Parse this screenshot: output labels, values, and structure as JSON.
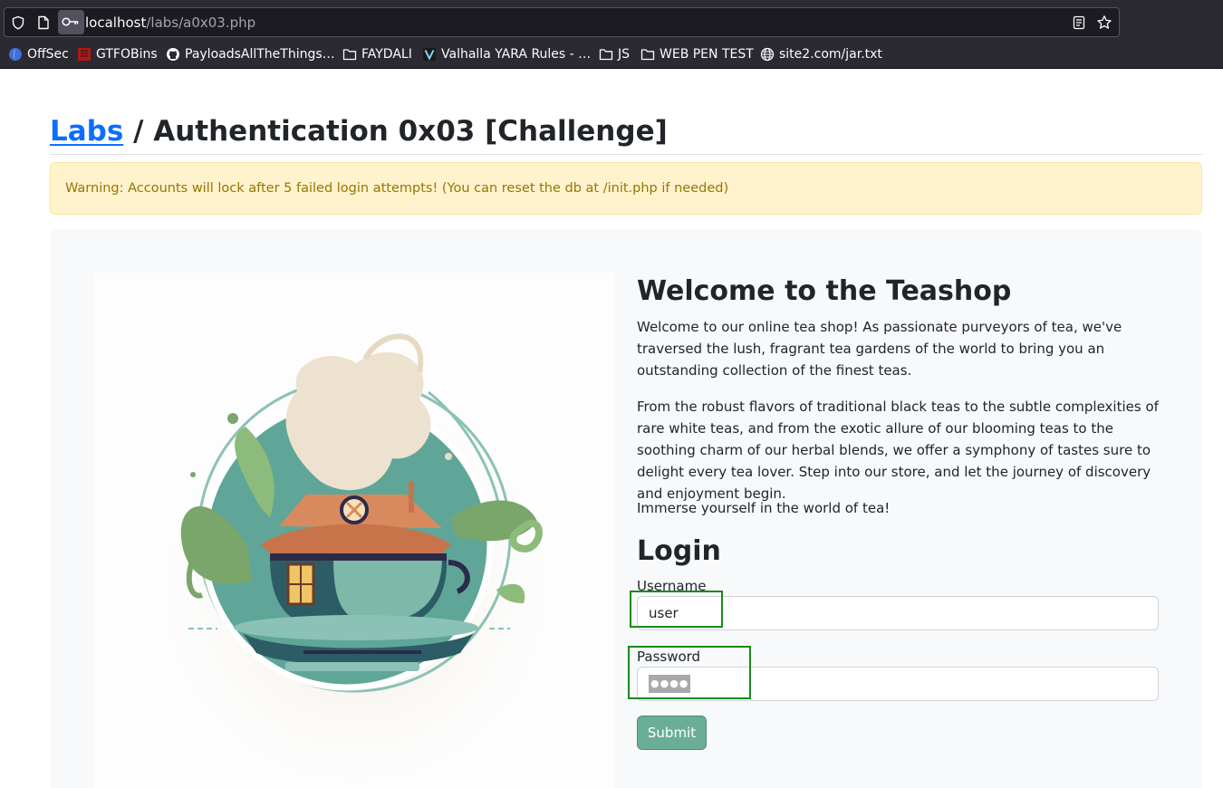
{
  "browser": {
    "url_host": "localhost",
    "url_path": "/labs/a0x03.php",
    "icons": [
      "shield-icon",
      "page-icon",
      "key-icon",
      "reader-view-icon",
      "bookmark-star-icon"
    ]
  },
  "bookmarks": [
    {
      "label": "OffSec",
      "icon": "offsec-icon"
    },
    {
      "label": "GTFOBins",
      "icon": "gtfobins-icon"
    },
    {
      "label": "PayloadsAllTheThings…",
      "icon": "github-icon"
    },
    {
      "label": "FAYDALI",
      "icon": "folder-icon"
    },
    {
      "label": "Valhalla YARA Rules - …",
      "icon": "valhalla-icon"
    },
    {
      "label": "JS",
      "icon": "folder-icon"
    },
    {
      "label": "WEB PEN TEST",
      "icon": "folder-icon"
    },
    {
      "label": "site2.com/jar.txt",
      "icon": "globe-icon"
    }
  ],
  "page": {
    "breadcrumb_link": "Labs",
    "breadcrumb_rest": " / Authentication 0x03 [Challenge]",
    "warning": "Warning: Accounts will lock after 5 failed login attempts! (You can reset the db at /init.php if needed)",
    "welcome_title": "Welcome to the Teashop",
    "paragraphs": [
      "Welcome to our online tea shop! As passionate purveyors of tea, we've traversed the lush, fragrant tea gardens of the world to bring you an outstanding collection of the finest teas.",
      "From the robust flavors of traditional black teas to the subtle complexities of rare white teas, and from the exotic allure of our blooming teas to the soothing charm of our herbal blends, we offer a symphony of tastes sure to delight every tea lover. Step into our store, and let the journey of discovery and enjoyment begin.",
      "Immerse yourself in the world of tea!"
    ],
    "image_icon": "teacup-house-illustration"
  },
  "login": {
    "title": "Login",
    "username_label": "Username",
    "username_value": "user",
    "password_label": "Password",
    "password_mask": "●●●●",
    "submit_label": "Submit"
  },
  "colors": {
    "link": "#0d6efd",
    "warning_bg": "#fff3cd",
    "warning_text": "#997404",
    "submit_bg": "#6aae96",
    "highlight_box": "#1a8a1a"
  }
}
